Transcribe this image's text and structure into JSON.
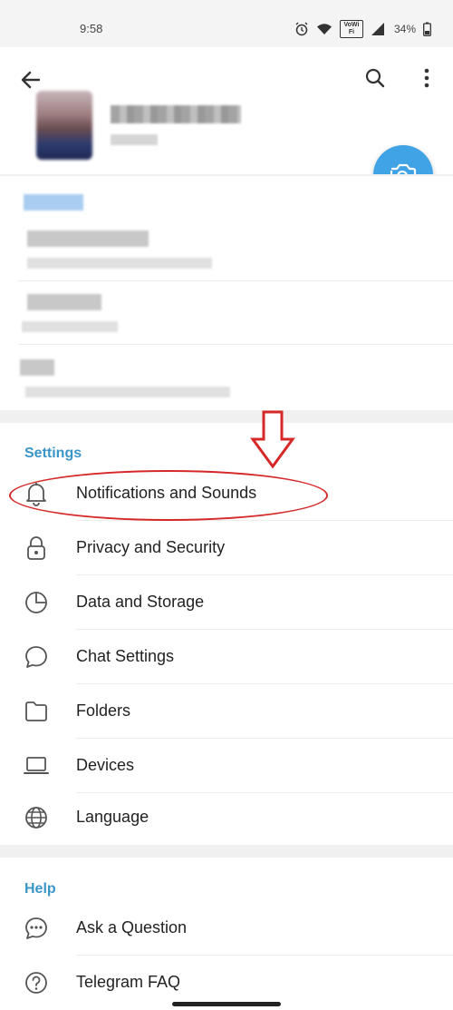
{
  "status_bar": {
    "time": "9:58",
    "volte_label": "VoWiFi",
    "battery": "34%"
  },
  "header": {
    "back_icon": "arrow-left",
    "search_icon": "search",
    "more_icon": "more-vertical",
    "camera_icon": "camera-add"
  },
  "settings": {
    "title": "Settings",
    "items": [
      {
        "label": "Notifications and Sounds",
        "icon": "bell"
      },
      {
        "label": "Privacy and Security",
        "icon": "lock"
      },
      {
        "label": "Data and Storage",
        "icon": "pie-chart"
      },
      {
        "label": "Chat Settings",
        "icon": "chat-bubble"
      },
      {
        "label": "Folders",
        "icon": "folder"
      },
      {
        "label": "Devices",
        "icon": "laptop"
      },
      {
        "label": "Language",
        "icon": "globe"
      }
    ]
  },
  "help": {
    "title": "Help",
    "items": [
      {
        "label": "Ask a Question",
        "icon": "chat-dots"
      },
      {
        "label": "Telegram FAQ",
        "icon": "question-circle"
      }
    ]
  },
  "colors": {
    "accent": "#3a95c9",
    "fab": "#3fa3e6",
    "annotation": "#d62828"
  }
}
